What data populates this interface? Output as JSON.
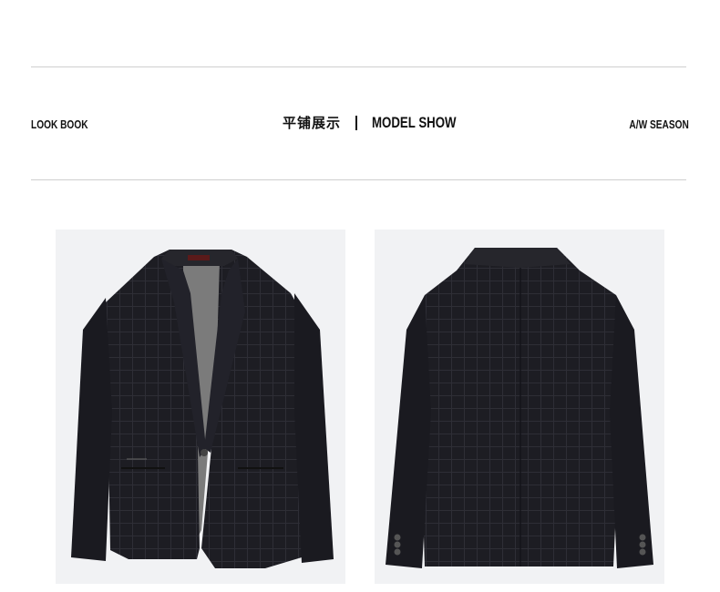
{
  "header": {
    "left_label": "LOOK BOOK",
    "center_cn": "平铺展示",
    "center_en": "MODEL SHOW",
    "right_label": "A/W SEASON"
  },
  "gallery": {
    "items": [
      {
        "view": "front",
        "image": "blazer-front-photo"
      },
      {
        "view": "back",
        "image": "blazer-back-photo"
      }
    ]
  },
  "colors": {
    "background": "#ffffff",
    "divider": "#cfcfcf",
    "photo_bg": "#f1f2f4",
    "jacket": "#1c1c22",
    "lining": "#7d7d7d"
  }
}
